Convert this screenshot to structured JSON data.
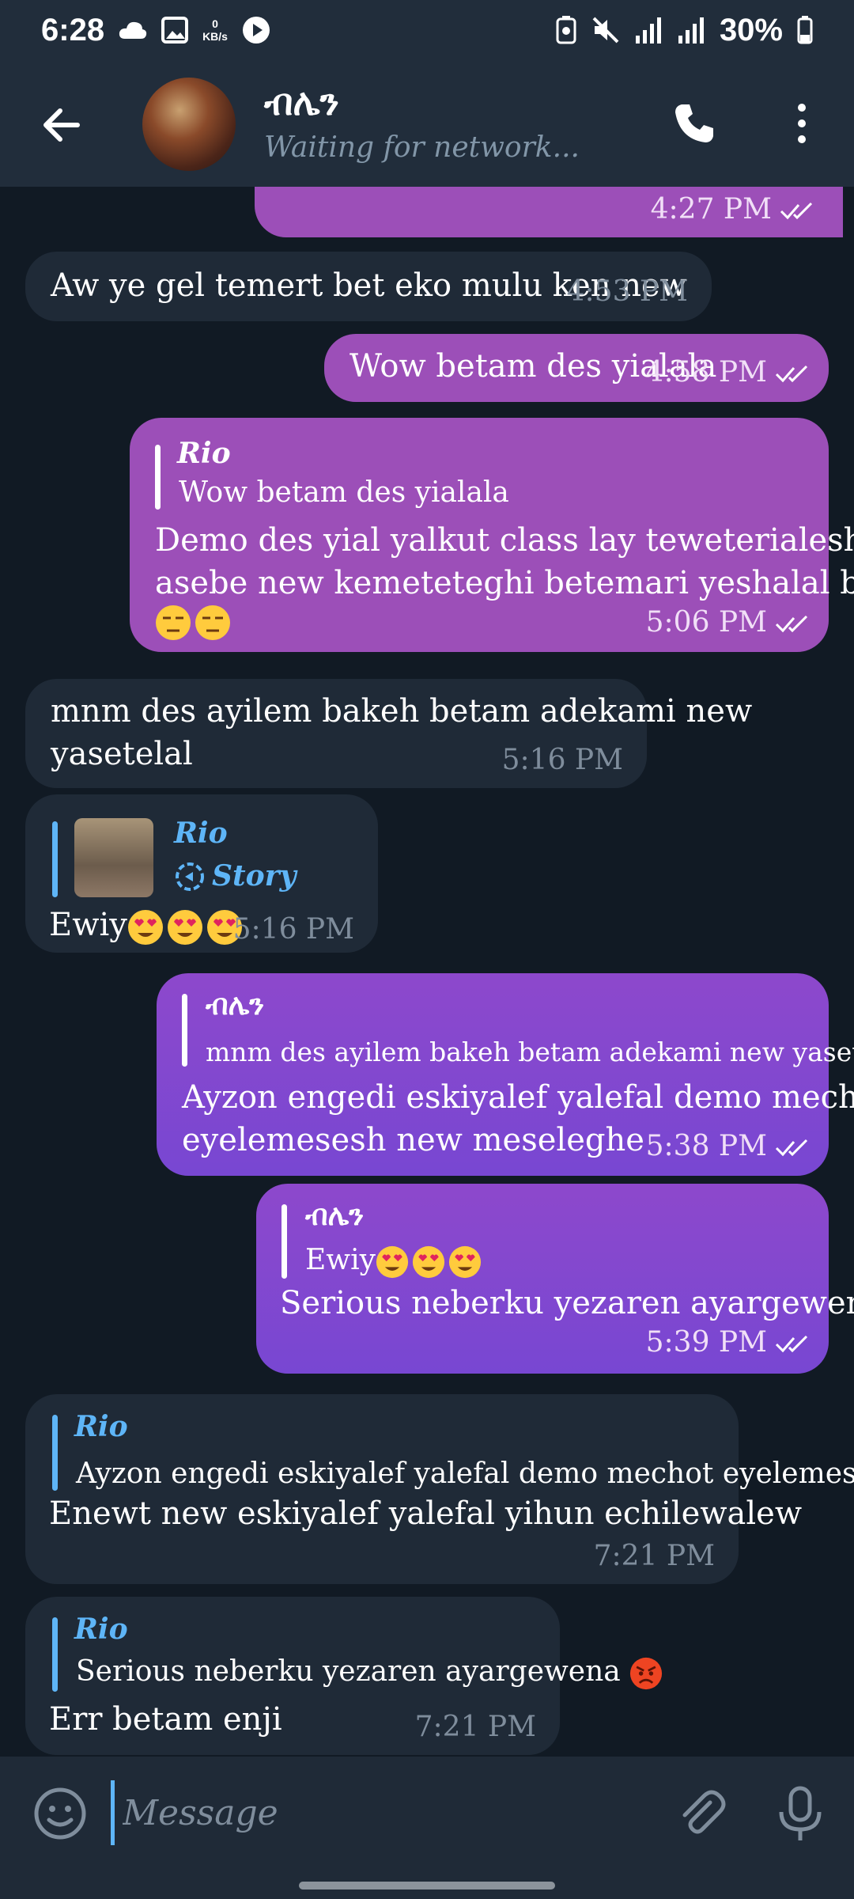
{
  "status_bar": {
    "time": "6:28",
    "net_speed_value": "0",
    "net_speed_unit": "KB/s",
    "battery": "30%"
  },
  "header": {
    "contact_name": "ብሌን",
    "status": "Waiting for network..."
  },
  "messages": [
    {
      "direction": "out",
      "text": "",
      "time": "4:27 PM",
      "read": true
    },
    {
      "direction": "in",
      "text": "Aw ye gel temert bet eko mulu ken new",
      "time": "4:53 PM"
    },
    {
      "direction": "out",
      "text": "Wow betam des yialala",
      "time": "4:58 PM",
      "read": true
    },
    {
      "direction": "out",
      "reply_to": {
        "name": "Rio",
        "text": "Wow betam des yialala"
      },
      "lines": [
        "Demo des yial yalkut class lay teweterialesh beye",
        "asebe new kemeteteghi betemari yeshalal beye nw"
      ],
      "emoji": [
        "unamused",
        "unamused"
      ],
      "time": "5:06 PM",
      "read": true
    },
    {
      "direction": "in",
      "lines": [
        "mnm des ayilem bakeh betam adekami new",
        "yasetelal"
      ],
      "time": "5:16 PM"
    },
    {
      "direction": "in",
      "reply_to": {
        "name": "Rio",
        "text": "Story"
      },
      "text": "Ewiy",
      "emoji": [
        "heart-eyes",
        "heart-eyes",
        "heart-eyes"
      ],
      "time": "5:16 PM"
    },
    {
      "direction": "out",
      "reply_to": {
        "name": "ብሌን",
        "text": "mnm des ayilem bakeh betam adekami new yasetelal"
      },
      "lines": [
        "Ayzon engedi eskiyalef yalefal demo mechot",
        "eyelemesesh new meseleghe"
      ],
      "time": "5:38 PM",
      "read": true
    },
    {
      "direction": "out",
      "reply_to": {
        "name": "ብሌን",
        "text": "Ewiy"
      },
      "text": "Serious neberku yezaren ayargewena",
      "time": "5:39 PM",
      "read": true
    },
    {
      "direction": "in",
      "reply_to": {
        "name": "Rio",
        "text": "Ayzon engedi eskiyalef yalefal demo mechot eyelemese..."
      },
      "text": "Enewt new eskiyalef yalefal yihun echilewalew",
      "time": "7:21 PM"
    },
    {
      "direction": "in",
      "reply_to": {
        "name": "Rio",
        "text": "Serious neberku yezaren ayargewena"
      },
      "text": "Err betam enji",
      "time": "7:21 PM"
    }
  ],
  "input": {
    "placeholder": "Message"
  },
  "icons": [
    "back-arrow-icon",
    "phone-icon",
    "more-vert-icon",
    "emoji-icon",
    "paperclip-icon",
    "mic-icon",
    "story-reply-icon",
    "double-check-icon"
  ],
  "colors": {
    "outgoing_bubble": "#9c4fb8",
    "outgoing_bubble_alt": "#7847d2",
    "incoming_bubble": "#1f2a37",
    "background": "#111a24",
    "accent": "#5eb5f7"
  }
}
